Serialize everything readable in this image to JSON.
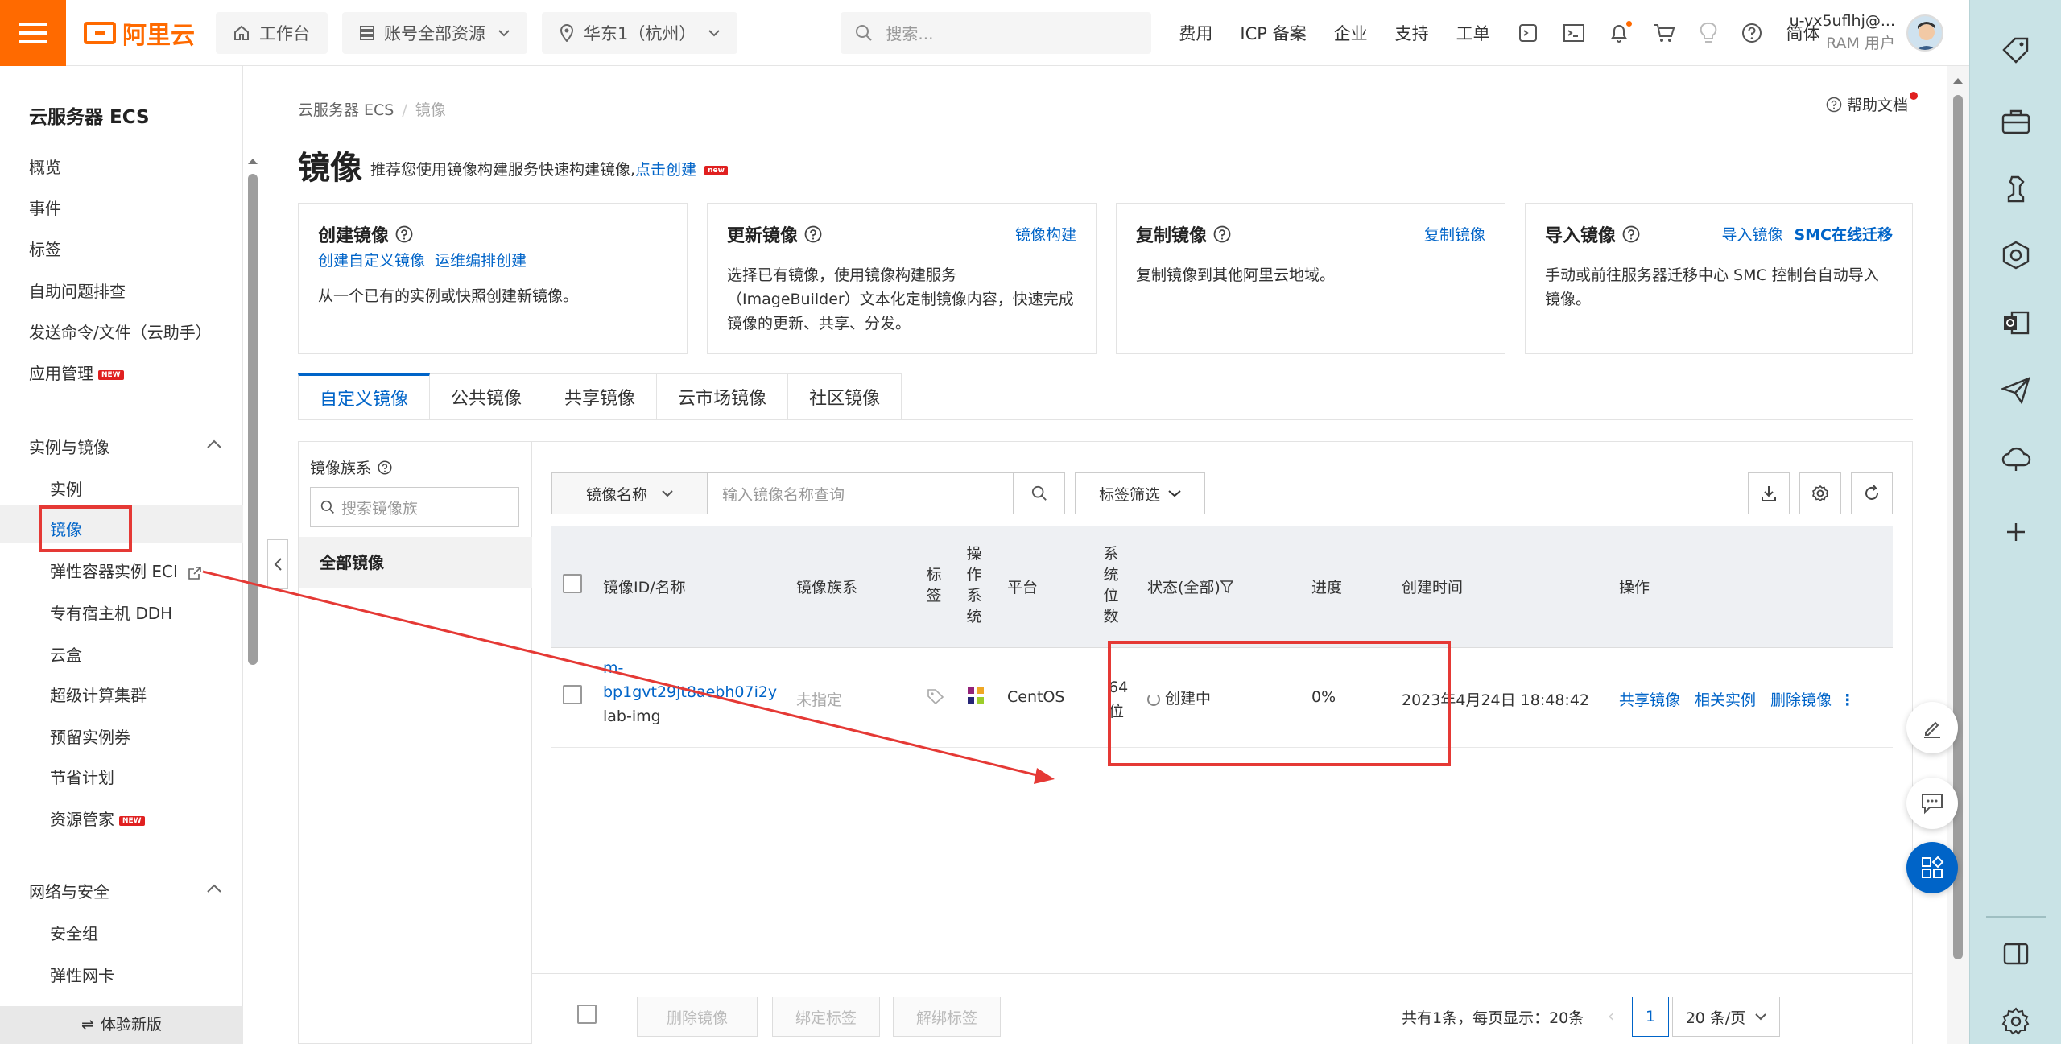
{
  "topbar": {
    "logo_text": "阿里云",
    "workbench": "工作台",
    "resources": "账号全部资源",
    "region": "华东1（杭州）",
    "search_placeholder": "搜索...",
    "nav": [
      "费用",
      "ICP 备案",
      "企业",
      "支持",
      "工单"
    ],
    "lang": "简体",
    "user_name": "u-vx5uflhj@...",
    "user_role": "RAM 用户"
  },
  "sidebar": {
    "title": "云服务器 ECS",
    "top_items": [
      "概览",
      "事件",
      "标签",
      "自助问题排查",
      "发送命令/文件（云助手）",
      "应用管理"
    ],
    "new_badge": "NEW",
    "section1": "实例与镜像",
    "section1_items": [
      "实例",
      "镜像",
      "弹性容器实例 ECI",
      "专有宿主机 DDH",
      "云盒",
      "超级计算集群",
      "预留实例券",
      "节省计划",
      "资源管家"
    ],
    "section2": "网络与安全",
    "section2_items": [
      "安全组",
      "弹性网卡"
    ],
    "bottom": "体验新版"
  },
  "main": {
    "breadcrumb": [
      "云服务器 ECS",
      "镜像"
    ],
    "help_doc": "帮助文档",
    "title": "镜像",
    "desc": "推荐您使用镜像构建服务快速构建镜像,",
    "desc_link": "点击创建",
    "desc_badge": "new",
    "cards": [
      {
        "title": "创建镜像",
        "links": [],
        "sublinks": [
          "创建自定义镜像",
          "运维编排创建"
        ],
        "desc": "从一个已有的实例或快照创建新镜像。"
      },
      {
        "title": "更新镜像",
        "links": [
          "镜像构建"
        ],
        "desc_lines": [
          "选择已有镜像，使用镜像构建服务",
          "（ImageBuilder）文本化定制镜像内容，快速完成",
          "镜像的更新、共享、分发。"
        ]
      },
      {
        "title": "复制镜像",
        "links": [
          "复制镜像"
        ],
        "desc": "复制镜像到其他阿里云地域。"
      },
      {
        "title": "导入镜像",
        "links": [
          "导入镜像",
          "SMC在线迁移"
        ],
        "desc_lines": [
          "手动或前往服务器迁移中心 SMC 控制台自动导入",
          "镜像。"
        ]
      }
    ],
    "tabs": [
      "自定义镜像",
      "公共镜像",
      "共享镜像",
      "云市场镜像",
      "社区镜像"
    ],
    "family": {
      "label": "镜像族系",
      "search_placeholder": "搜索镜像族",
      "all": "全部镜像"
    },
    "filter": {
      "select": "镜像名称",
      "input_placeholder": "输入镜像名称查询",
      "tag_filter": "标签筛选"
    },
    "table": {
      "headers": {
        "id_name": "镜像ID/名称",
        "family": "镜像族系",
        "tag": "标签",
        "os": "操作系统",
        "platform": "平台",
        "bits": "系统位数",
        "status": "状态(全部)",
        "progress": "进度",
        "created": "创建时间",
        "actions": "操作"
      },
      "rows": [
        {
          "id_line1": "m-",
          "id_line2": "bp1gvt29jt8aebh07i2y",
          "name": "lab-img",
          "family": "未指定",
          "platform": "CentOS",
          "bits_line1": "64",
          "bits_line2": "位",
          "status": "创建中",
          "progress": "0%",
          "created": "2023年4月24日 18:48:42",
          "actions": [
            "共享镜像",
            "相关实例",
            "删除镜像"
          ]
        }
      ]
    },
    "footer": {
      "buttons": [
        "删除镜像",
        "绑定标签",
        "解绑标签"
      ],
      "page_info": "共有1条，每页显示：20条",
      "page": "1",
      "page_size": "20 条/页"
    }
  },
  "colors": {
    "brand": "#ff6a00",
    "link": "#0064c8",
    "annotation": "#e53935"
  }
}
